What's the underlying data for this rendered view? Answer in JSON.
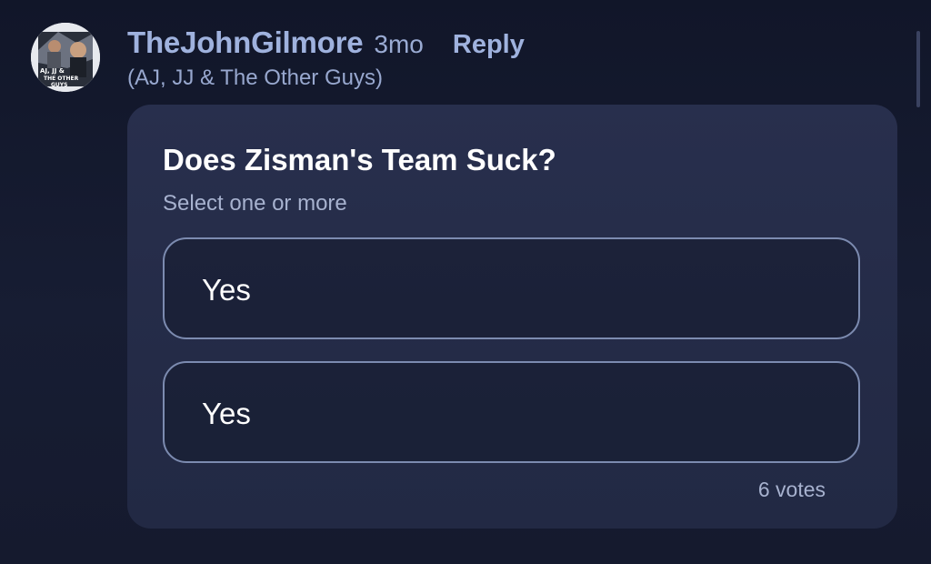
{
  "comment": {
    "author": "TheJohnGilmore",
    "time_ago": "3mo",
    "reply_label": "Reply",
    "group": "(AJ, JJ & The Other Guys)",
    "avatar_icon": "user-avatar-image"
  },
  "avatar_text": "AJ, JJ & THE OTHER GUYS",
  "poll": {
    "question": "Does Zisman's Team Suck?",
    "instruction": "Select one or more",
    "options": [
      {
        "label": "Yes"
      },
      {
        "label": "Yes"
      }
    ],
    "votes": "6 votes"
  },
  "colors": {
    "background": "#151b2f",
    "card": "#262d4a",
    "accent": "#9fb2de",
    "option_border": "#7c8bb0"
  }
}
